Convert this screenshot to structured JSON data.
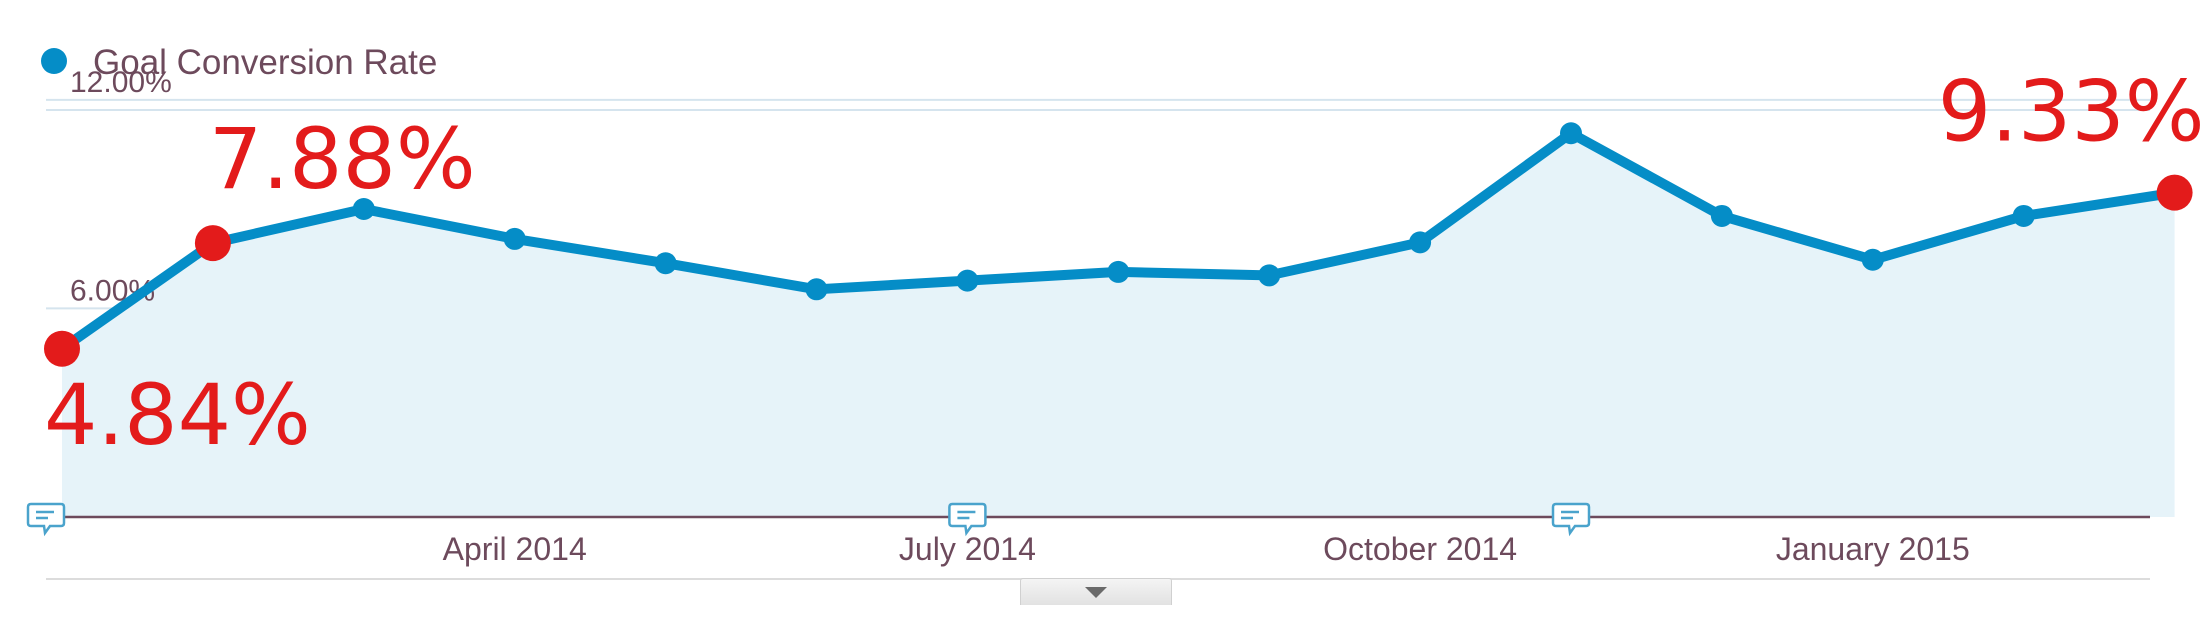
{
  "chart_data": {
    "type": "area",
    "legend": {
      "label": "Goal Conversion Rate",
      "color": "#058dc7",
      "placement": "top-left"
    },
    "x": [
      "2014-01",
      "2014-02",
      "2014-03",
      "2014-04",
      "2014-05",
      "2014-06",
      "2014-07",
      "2014-08",
      "2014-09",
      "2014-10",
      "2014-11",
      "2014-12",
      "2015-01",
      "2015-02",
      "2015-03"
    ],
    "y": [
      4.84,
      7.88,
      8.86,
      8.0,
      7.3,
      6.55,
      6.8,
      7.05,
      6.95,
      7.9,
      11.04,
      8.66,
      7.4,
      8.66,
      9.33
    ],
    "x_tick_labels": [
      "April 2014",
      "July 2014",
      "October 2014",
      "January 2015"
    ],
    "x_tick_positions": [
      "2014-04",
      "2014-07",
      "2014-10",
      "2015-01"
    ],
    "y_tick_labels": [
      "12.00%",
      "6.00%"
    ],
    "y_ticks": [
      12,
      6
    ],
    "ylim": [
      0,
      12.6
    ],
    "grid": true,
    "annotation_markers": [
      "2014-01",
      "2014-07",
      "2014-11"
    ],
    "highlighted_points": [
      {
        "x": "2014-01",
        "label": "4.84%"
      },
      {
        "x": "2014-02",
        "label": "7.88%"
      },
      {
        "x": "2015-03",
        "label": "9.33%"
      }
    ],
    "colors": {
      "line": "#058dc7",
      "fill": "#e6f3f9",
      "highlight": "#e31b1b",
      "axis": "#6d4a5c",
      "grid": "#d5e4ee"
    }
  }
}
